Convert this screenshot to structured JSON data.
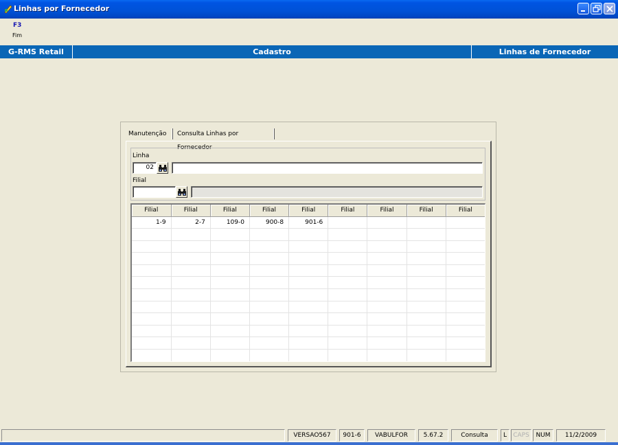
{
  "window": {
    "title": "Linhas por Fornecedor",
    "controls": [
      "minimize-icon",
      "restore-icon",
      "close-icon"
    ]
  },
  "shortcut": {
    "key": "F3",
    "label": "Fim"
  },
  "header": {
    "left": "G-RMS Retail",
    "center": "Cadastro",
    "right": "Linhas de Fornecedor"
  },
  "tabs": [
    {
      "label": "Manutenção",
      "active": true
    },
    {
      "label": "Consulta Linhas por Fornecedor",
      "active": false
    }
  ],
  "form": {
    "linha": {
      "label": "Linha",
      "code": "02",
      "description": ""
    },
    "filial": {
      "label": "Filial",
      "code": "",
      "description": ""
    }
  },
  "grid": {
    "columns": [
      "Filial",
      "Filial",
      "Filial",
      "Filial",
      "Filial",
      "Filial",
      "Filial",
      "Filial",
      "Filial"
    ],
    "rows": [
      [
        "1-9",
        "2-7",
        "109-0",
        "900-8",
        "901-6",
        "",
        "",
        "",
        ""
      ]
    ]
  },
  "status": {
    "panels": [
      "",
      "VERSAO567",
      "901-6",
      "VABULFOR",
      "5.67.2",
      "Consulta",
      "L",
      "CAPS",
      "NUM",
      "11/2/2009"
    ]
  },
  "colors": {
    "titlebar": "#0054e3",
    "header": "#0a66b6",
    "background": "#ece9d8"
  }
}
